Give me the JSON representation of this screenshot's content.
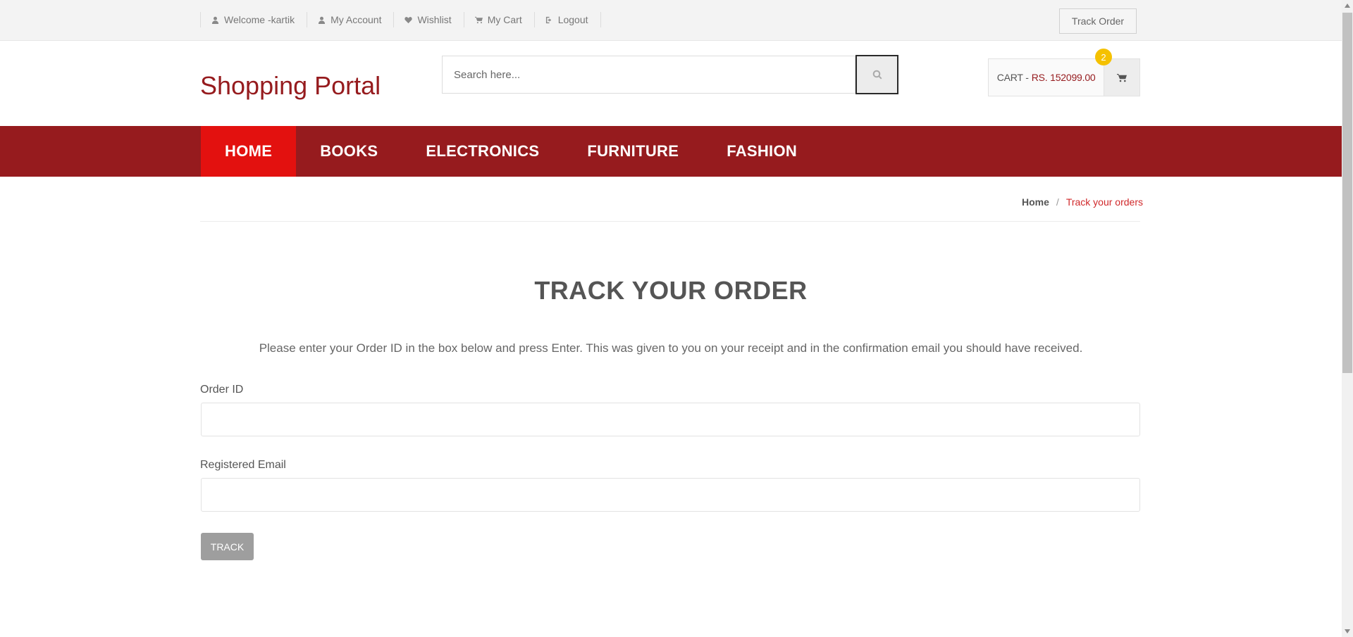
{
  "topbar": {
    "links": [
      {
        "label": "Welcome -kartik",
        "icon": "user-icon"
      },
      {
        "label": "My Account",
        "icon": "user-icon"
      },
      {
        "label": "Wishlist",
        "icon": "heart-icon"
      },
      {
        "label": "My Cart",
        "icon": "cart-icon"
      },
      {
        "label": "Logout",
        "icon": "sign-out-icon"
      }
    ],
    "track_order": "Track Order"
  },
  "header": {
    "logo": "Shopping Portal",
    "search_placeholder": "Search here...",
    "cart_label": "CART -",
    "cart_amount": "RS. 152099.00",
    "cart_count": "2"
  },
  "nav": {
    "items": [
      "HOME",
      "BOOKS",
      "ELECTRONICS",
      "FURNITURE",
      "FASHION"
    ],
    "active": "HOME"
  },
  "breadcrumb": {
    "home": "Home",
    "separator": "/",
    "current": "Track your orders"
  },
  "main": {
    "title": "TRACK YOUR ORDER",
    "intro": "Please enter your Order ID in the box below and press Enter. This was given to you on your receipt and in the confirmation email you should have received.",
    "order_id_label": "Order ID",
    "email_label": "Registered Email",
    "submit_label": "TRACK"
  },
  "colors": {
    "brand": "#961b1e",
    "nav_active": "#e3110f",
    "badge": "#f5c100"
  }
}
